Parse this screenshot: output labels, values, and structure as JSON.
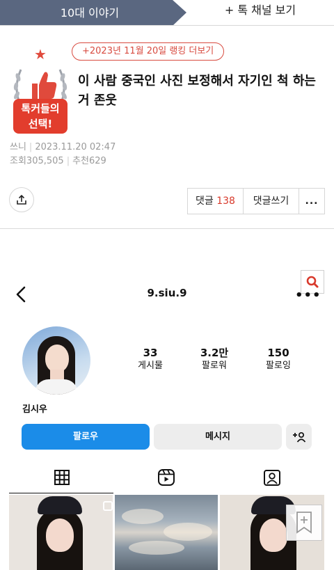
{
  "top_tabs": {
    "active": "10대 이야기",
    "other": "+ 톡 채널 보기"
  },
  "badge": {
    "line1": "톡커들의",
    "line2": "선택!"
  },
  "ranking_pill": "+2023년 11월 20일 랭킹 더보기",
  "post": {
    "title": "이 사람 중국인 사진 보정해서 자기인 척 하는 거 존웃",
    "author": "쓰니",
    "date": "2023.11.20 02:47",
    "views_label": "조회",
    "views": "305,505",
    "likes_label": "추천",
    "likes": "629"
  },
  "actions": {
    "comment_label": "댓글",
    "comment_count": "138",
    "write_comment": "댓글쓰기",
    "more": "..."
  },
  "instagram": {
    "username": "9.siu.9",
    "stats": [
      {
        "value": "33",
        "label": "게시물"
      },
      {
        "value": "3.2만",
        "label": "팔로워"
      },
      {
        "value": "150",
        "label": "팔로잉"
      }
    ],
    "display_name": "김시우",
    "follow_button": "팔로우",
    "message_button": "메시지"
  },
  "colors": {
    "tab_active_bg": "#5a6780",
    "accent_red": "#d84a3f",
    "follow_blue": "#1b8ce8"
  }
}
